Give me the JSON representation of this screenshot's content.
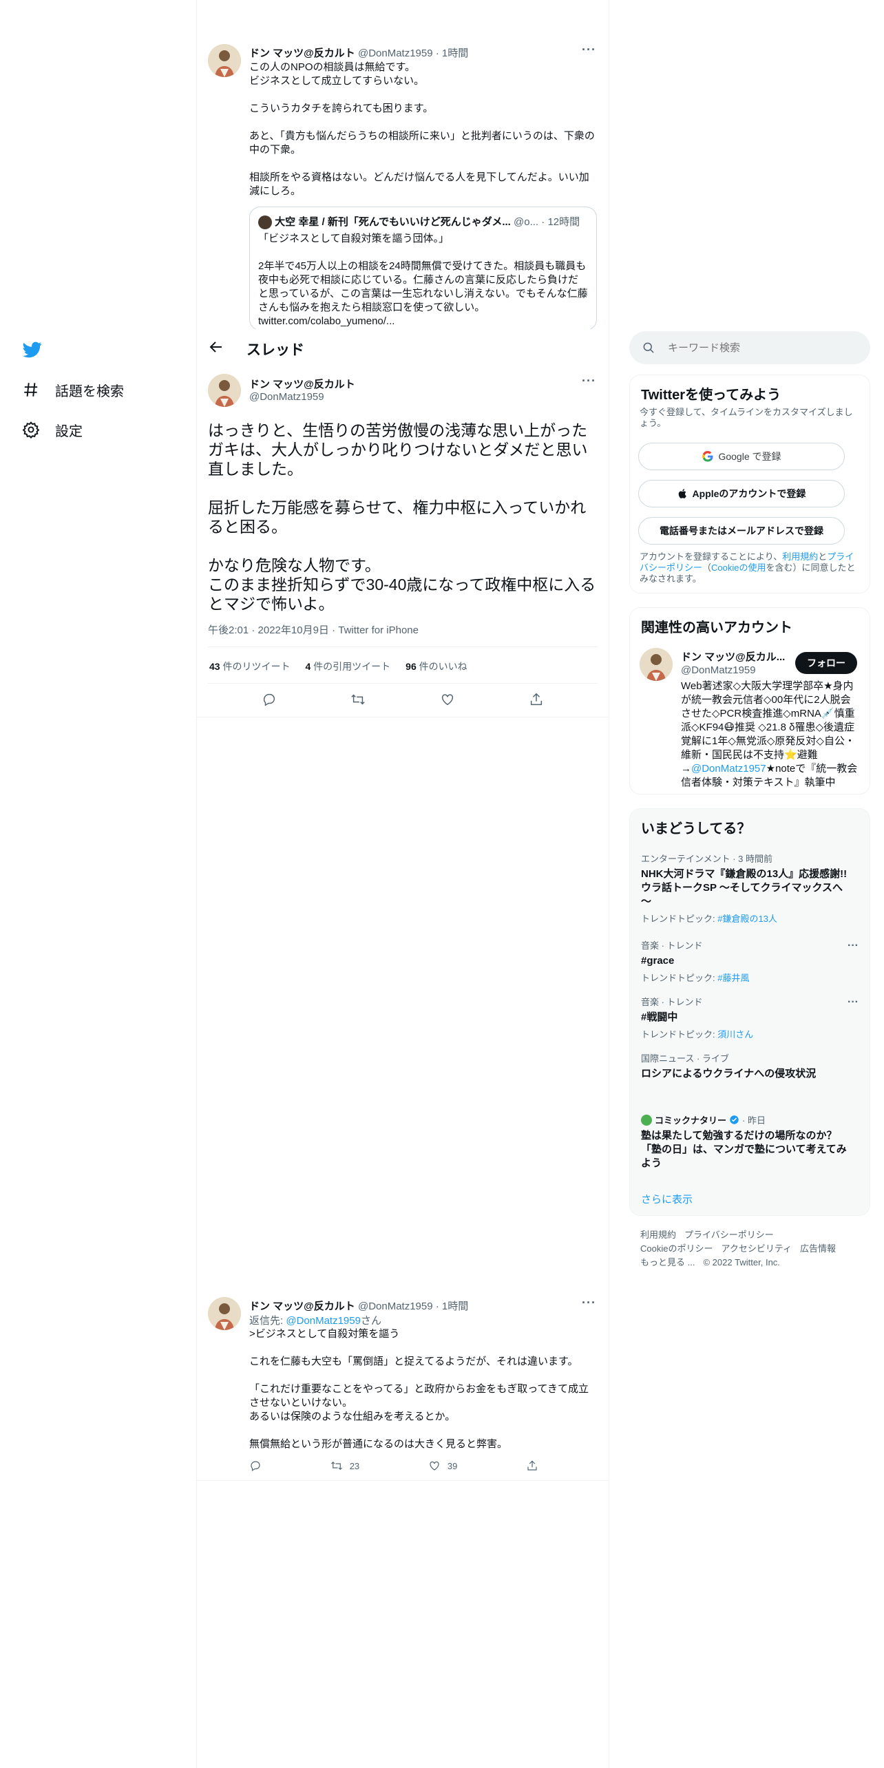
{
  "nav": {
    "explore_label": "話題を検索",
    "settings_label": "設定"
  },
  "tweets": {
    "top": {
      "name": "ドン マッツ@反カルト",
      "handle": "@DonMatz1959",
      "time": "· 1時間",
      "body": "この人のNPOの相談員は無給です。\nビジネスとして成立してすらいない。\n\nこういうカタチを誇られても困ります。\n\nあと、「貴方も悩んだらうちの相談所に来い」と批判者にいうのは、下衆の中の下衆。\n\n相談所をやる資格はない。どんだけ悩んでる人を見下してんだよ。いい加減にしろ。",
      "quote": {
        "name": "大空 幸星 / 新刊「死んでもいいけど死んじゃダメ...",
        "handle": "@o...",
        "time": "· 12時間",
        "body": "「ビジネスとして自殺対策を謳う団体。」\n\n2年半で45万人以上の相談を24時間無償で受けてきた。相談員も職員も夜中も必死で相談に応じている。仁藤さんの言葉に反応したら負けだと思っているが、この言葉は一生忘れないし消えない。でもそんな仁藤さんも悩みを抱えたら相談窓口を使って欲しい。\ntwitter.com/colabo_yumeno/..."
      }
    },
    "header_title": "スレッド",
    "focus": {
      "name": "ドン マッツ@反カルト",
      "handle": "@DonMatz1959",
      "body": "はっきりと、生悟りの苦労傲慢の浅薄な思い上がったガキは、大人がしっかり叱りつけないとダメだと思い直しました。\n\n屈折した万能感を募らせて、権力中枢に入っていかれると困る。\n\nかなり危険な人物です。\nこのまま挫折知らずで30-40歳になって政権中枢に入るとマジで怖いよ。",
      "meta": "午後2:01 · 2022年10月9日 · Twitter for iPhone",
      "retweets_count": "43",
      "retweets_label": "件のリツイート",
      "quotes_count": "4",
      "quotes_label": "件の引用ツイート",
      "likes_count": "96",
      "likes_label": "件のいいね"
    },
    "reply": {
      "name": "ドン マッツ@反カルト",
      "handle": "@DonMatz1959",
      "time": "· 1時間",
      "reply_prefix": "返信先: ",
      "reply_to": "@DonMatz1959",
      "reply_suffix": "さん",
      "body": ">ビジネスとして自殺対策を謳う\n\nこれを仁藤も大空も「罵倒語」と捉えてるようだが、それは違います。\n\n「これだけ重要なことをやってる」と政府からお金をもぎ取ってきて成立させないといけない。\nあるいは保険のような仕組みを考えるとか。\n\n無償無給という形が普通になるのは大きく見ると弊害。",
      "retweets": "23",
      "likes": "39"
    }
  },
  "sidebar": {
    "search_placeholder": "キーワード検索",
    "signup": {
      "title": "Twitterを使ってみよう",
      "subtitle": "今すぐ登録して、タイムラインをカスタマイズしましょう。",
      "google_label": "Google で登録",
      "apple_label": "Appleのアカウントで登録",
      "phone_label": "電話番号またはメールアドレスで登録",
      "terms_1": "アカウントを登録することにより、",
      "terms_link_1": "利用規約",
      "terms_2": "と",
      "terms_link_2": "プライバシーポリシー",
      "terms_3": "（",
      "terms_link_3": "Cookieの使用",
      "terms_4": "を含む）に同意したとみなされます。"
    },
    "related": {
      "title": "関連性の高いアカウント",
      "name": "ドン マッツ@反カル...",
      "handle": "@DonMatz1959",
      "follow_label": "フォロー",
      "bio_1": "Web著述家◇大阪大学理学部卒★身内が統一教会元信者◇00年代に2人脱会させた◇PCR検査推進◇mRNA💉慎重派◇KF94😷推奨 ◇21.8 δ罹患◇後遺症覚解に1年◇無党派◇原発反対◇自公・維新・国民民は不支持⭐️避難→",
      "bio_link": "@DonMatz1957",
      "bio_2": "★noteで『統一教会信者体験・対策テキスト』執筆中"
    },
    "trends": {
      "title": "いまどうしてる？",
      "items": [
        {
          "context": "エンターテインメント · 3 時間前",
          "title": "NHK大河ドラマ『鎌倉殿の13人』応援感謝!!ウラ話トークSP ～そしてクライマックスへ～",
          "sub_label": "トレンドトピック: ",
          "sub_value": "#鎌倉殿の13人"
        },
        {
          "context": "音楽 · トレンド",
          "title": "#grace",
          "sub_label": "トレンドトピック: ",
          "sub_value": "#藤井風"
        },
        {
          "context": "音楽 · トレンド",
          "title": "#戦闘中",
          "sub_label": "トレンドトピック: ",
          "sub_value": "須川さん"
        },
        {
          "context": "国際ニュース · ライブ",
          "title": "ロシアによるウクライナへの侵攻状況"
        },
        {
          "source": "コミックナタリー",
          "time": "· 昨日",
          "title": "塾は果たして勉強するだけの場所なのか？「塾の日」は、マンガで塾について考えてみよう"
        }
      ],
      "show_more": "さらに表示"
    },
    "footer": {
      "links": [
        "利用規約",
        "プライバシーポリシー",
        "Cookieのポリシー",
        "アクセシビリティ",
        "広告情報",
        "もっと見る ..."
      ],
      "copyright": "© 2022 Twitter, Inc."
    }
  },
  "colors": {
    "accent": "#1d9bf0",
    "text": "#0f1419",
    "muted": "#536471",
    "border": "#eff3f4"
  }
}
